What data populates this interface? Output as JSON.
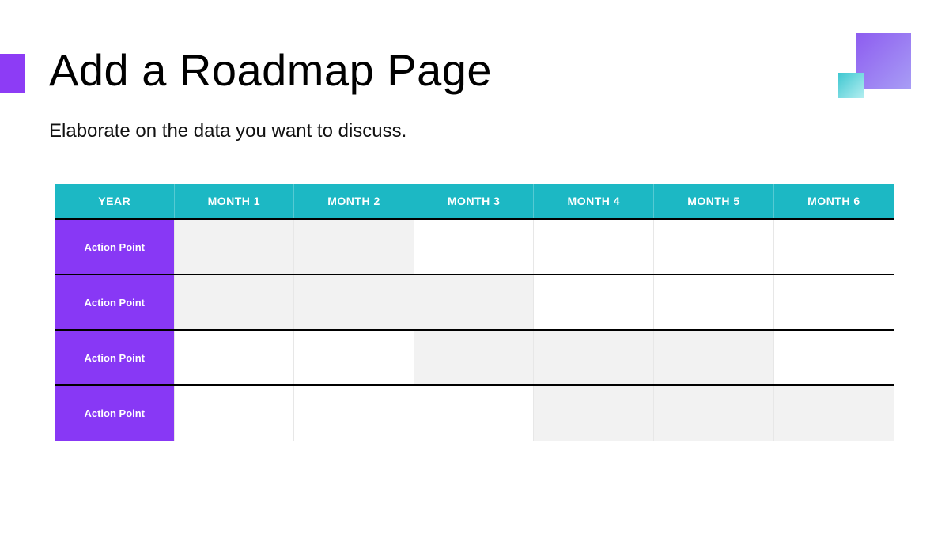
{
  "title": "Add a Roadmap Page",
  "subtitle": "Elaborate on the data you want to discuss.",
  "table": {
    "headers": [
      "YEAR",
      "MONTH 1",
      "MONTH 2",
      "MONTH 3",
      "MONTH 4",
      "MONTH 5",
      "MONTH 6"
    ],
    "rows": [
      {
        "label": "Action Point",
        "shaded": [
          true,
          true,
          false,
          false,
          false,
          false
        ]
      },
      {
        "label": "Action Point",
        "shaded": [
          true,
          true,
          true,
          false,
          false,
          false
        ]
      },
      {
        "label": "Action Point",
        "shaded": [
          false,
          false,
          true,
          true,
          true,
          false
        ]
      },
      {
        "label": "Action Point",
        "shaded": [
          false,
          false,
          false,
          true,
          true,
          true
        ]
      }
    ]
  }
}
